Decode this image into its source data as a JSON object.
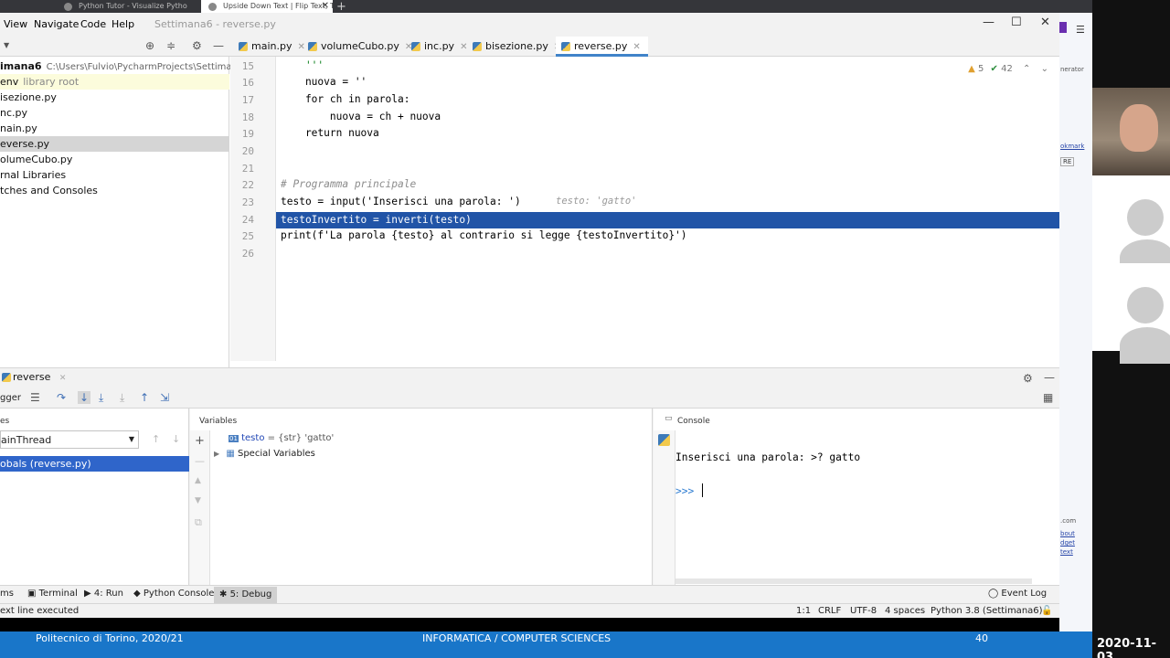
{
  "browser": {
    "tabs": [
      {
        "label": "Python Tutor - Visualize Pytho",
        "active": false
      },
      {
        "label": "Upside Down Text | Flip Text, T",
        "active": true
      }
    ]
  },
  "ide": {
    "window_title": "Settimana6 - reverse.py",
    "menu": [
      "View",
      "Navigate",
      "Code",
      "Help"
    ],
    "editor_tabs": [
      {
        "label": "main.py",
        "active": false
      },
      {
        "label": "volumeCubo.py",
        "active": false
      },
      {
        "label": "inc.py",
        "active": false
      },
      {
        "label": "bisezione.py",
        "active": false
      },
      {
        "label": "reverse.py",
        "active": true
      }
    ],
    "project_tree": [
      {
        "label": "imana6",
        "extra": "C:\\Users\\Fulvio\\PycharmProjects\\Settimana6",
        "bold": true
      },
      {
        "label": "env",
        "extra": "library root",
        "highlight": true
      },
      {
        "label": "isezione.py"
      },
      {
        "label": "nc.py"
      },
      {
        "label": "nain.py"
      },
      {
        "label": "everse.py",
        "selected": true
      },
      {
        "label": "olumeCubo.py"
      },
      {
        "label": "rnal Libraries"
      },
      {
        "label": "tches and Consoles"
      }
    ],
    "inspection": {
      "warnings": "5",
      "typos": "42"
    },
    "code_lines": [
      {
        "n": "15",
        "text": "    '''"
      },
      {
        "n": "16",
        "text": "    nuova = ''"
      },
      {
        "n": "17",
        "text": "    for ch in parola:"
      },
      {
        "n": "18",
        "text": "        nuova = ch + nuova"
      },
      {
        "n": "19",
        "text": "    return nuova"
      },
      {
        "n": "20",
        "text": ""
      },
      {
        "n": "21",
        "text": ""
      },
      {
        "n": "22",
        "text": "# Programma principale"
      },
      {
        "n": "23",
        "text": "testo = input('Inserisci una parola: ')",
        "hint": "testo: 'gatto'"
      },
      {
        "n": "24",
        "text": "testoInvertito = inverti(testo)",
        "current": true
      },
      {
        "n": "25",
        "text": "print(f'La parola {testo} al contrario si legge {testoInvertito}')"
      },
      {
        "n": "26",
        "text": ""
      }
    ]
  },
  "debug": {
    "tab_label": "reverse",
    "toolbar_label": "gger",
    "frames_title": "es",
    "thread": "ainThread",
    "frame": "obals (reverse.py)",
    "variables_title": "Variables",
    "variables": [
      {
        "name": "testo",
        "value": " = {str} 'gatto'",
        "type": "01"
      },
      {
        "name": "Special Variables",
        "value": "",
        "type": "group"
      }
    ],
    "console_title": "Console",
    "console_lines": [
      "Inserisci una parola: >? gatto",
      "",
      ">>> "
    ]
  },
  "bottom_tabs": [
    {
      "label": "ms"
    },
    {
      "label": "Terminal"
    },
    {
      "label": "4: Run"
    },
    {
      "label": "Python Console"
    },
    {
      "label": "5: Debug",
      "active": true
    },
    {
      "label": "Event Log"
    }
  ],
  "status": {
    "message": "ext line executed",
    "position": "1:1",
    "line_sep": "CRLF",
    "encoding": "UTF-8",
    "indent": "4 spaces",
    "interpreter": "Python 3.8 (Settimana6)"
  },
  "bg_page_links": [
    "nerator",
    "okmark",
    "RE",
    ".com",
    "bout",
    "dget",
    "text"
  ],
  "footer": {
    "left": "Politecnico di Torino, 2020/21",
    "center": "INFORMATICA / COMPUTER SCIENCES",
    "page": "40"
  },
  "date": "2020-11-03"
}
